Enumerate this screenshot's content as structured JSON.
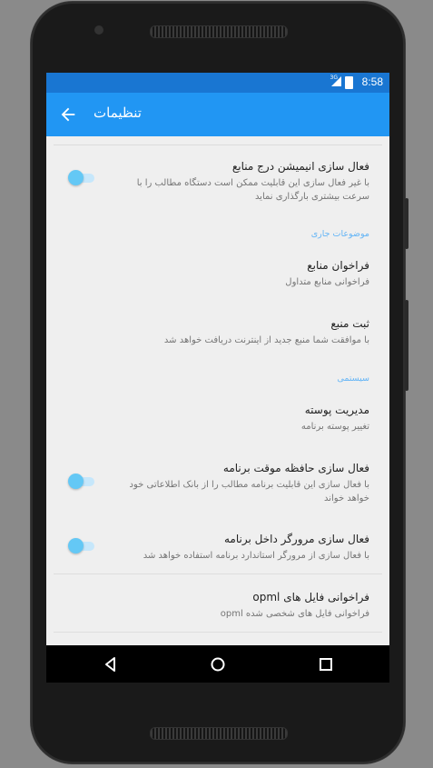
{
  "status_bar": {
    "time": "8:58",
    "network": "3G"
  },
  "app_bar": {
    "title": "تنظیمات"
  },
  "settings": {
    "animation": {
      "title": "فعال سازی انیمیشن درج منابع",
      "summary": "با غیر فعال سازی این قابلیت ممکن است دستگاه مطالب را با سرعت بیشتری بارگذاری نماید"
    },
    "category_current": "موضوعات جاری",
    "fetch_sources": {
      "title": "فراخوان منابع",
      "summary": "فراخوانی منابع متداول"
    },
    "register_source": {
      "title": "ثبت منبع",
      "summary": "با موافقت شما منبع جدید از اینترنت دریافت خواهد شد"
    },
    "category_system": "سیستمی",
    "skin": {
      "title": "مدیریت پوسته",
      "summary": "تغییر پوسته برنامه"
    },
    "cache": {
      "title": "فعال سازی حافظه موقت برنامه",
      "summary": "با فعال سازی این قابلیت برنامه مطالب را از بانک اطلاعاتی خود خواهد خواند"
    },
    "browser": {
      "title": "فعال سازی مرورگر داخل برنامه",
      "summary": "با فعال سازی از مرورگر استاندارد برنامه استفاده خواهد شد"
    },
    "opml": {
      "title": "فراخوانی فایل های opml",
      "summary": "فراخوانی فایل های شخصی شده opml"
    }
  },
  "icons": {
    "back": "arrow-left-icon",
    "nav_back": "triangle-back-icon",
    "nav_home": "circle-home-icon",
    "nav_recents": "square-recents-icon"
  },
  "colors": {
    "status_bar": "#1976d2",
    "app_bar": "#2196f3",
    "accent": "#64b5f6",
    "switch_thumb": "#64c8f5"
  }
}
